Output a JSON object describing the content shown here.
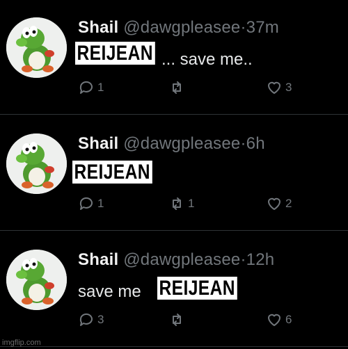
{
  "tweets": [
    {
      "name": "Shail",
      "handle": "@dawgpleasee",
      "time": "37m",
      "text": "... save me..",
      "overlay": "REIJEAN",
      "replies": "1",
      "retweets": "",
      "likes": "3"
    },
    {
      "name": "Shail",
      "handle": "@dawgpleasee",
      "time": "6h",
      "text": "",
      "overlay": "REIJEAN",
      "replies": "1",
      "retweets": "1",
      "likes": "2"
    },
    {
      "name": "Shail",
      "handle": "@dawgpleasee",
      "time": "12h",
      "text": "save me",
      "overlay": "REIJEAN",
      "replies": "3",
      "retweets": "",
      "likes": "6"
    }
  ],
  "separator": "·",
  "watermark": "imgflip.com",
  "icons": {
    "reply": "reply-icon",
    "retweet": "retweet-icon",
    "like": "heart-icon",
    "avatar": "yoshi-avatar"
  },
  "colors": {
    "background": "#000000",
    "muted": "#71767b",
    "text": "#e7e9ea"
  }
}
